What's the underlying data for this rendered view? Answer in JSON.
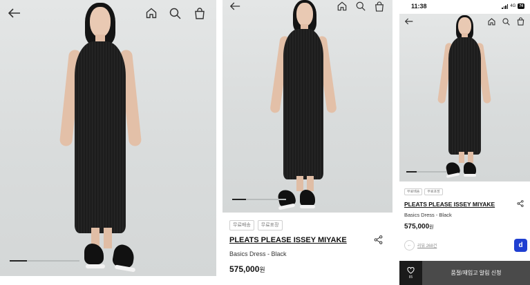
{
  "panel1": {
    "icons": [
      "back-arrow-icon",
      "home-icon",
      "search-icon",
      "shopping-bag-icon"
    ],
    "slide_progress": 0.25
  },
  "panel2": {
    "icons": [
      "back-arrow-icon",
      "home-icon",
      "search-icon",
      "shopping-bag-icon",
      "share-icon"
    ],
    "slide_progress": 0.25,
    "tags": [
      "무료배송",
      "무료포장"
    ],
    "brand": "PLEATS PLEASE ISSEY MIYAKE",
    "product_name": "Basics Dress - Black",
    "price": "575,000",
    "currency": "원"
  },
  "panel3": {
    "status": {
      "time": "11:38",
      "network": "4G",
      "battery": "74"
    },
    "icons": [
      "back-arrow-icon",
      "home-icon",
      "search-icon",
      "shopping-bag-icon",
      "share-icon"
    ],
    "slide_progress": 0.25,
    "tags": [
      "무료배송",
      "무료포장"
    ],
    "brand": "PLEATS PLEASE ISSEY MIYAKE",
    "product_name": "Basics Dress - Black",
    "price": "575,000",
    "currency": "원",
    "review_link": "리뷰 268건",
    "chat_label": "d",
    "wish_count": "85",
    "restock_label": "품절/재입고 알림 신청"
  },
  "colors": {
    "photo_bg": "#dadddd",
    "chat_blue": "#1f3fd1",
    "restock_bg": "#4a4a4a",
    "wish_bg": "#1b1b1b"
  }
}
